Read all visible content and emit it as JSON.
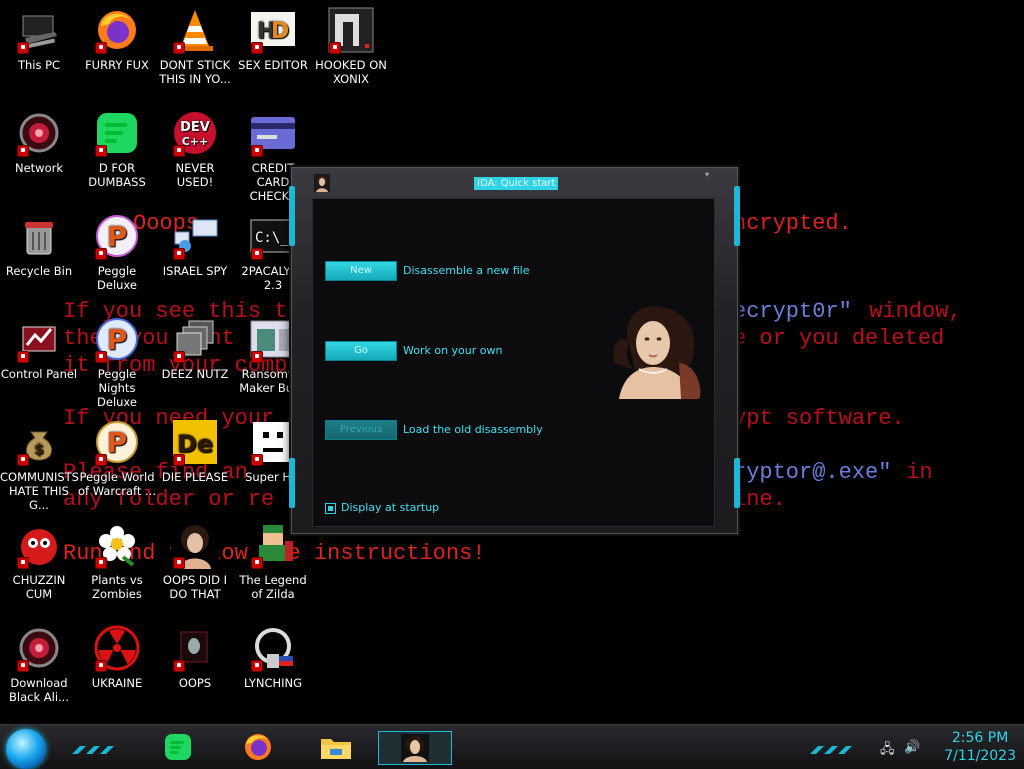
{
  "wallpaper": {
    "line1": "Ooops,",
    "line1_right": "ncrypted.",
    "line2": "If you see this t",
    "line2_right_blue": "ecrypt0r\"",
    "line2_right": " window,",
    "line3": "then you cant",
    "line3_right": "e or you deleted",
    "line4": "it from your comp",
    "line5": "If you need your",
    "line5_right": "ypt software.",
    "line6": "Please find an",
    "line6_right_blue": "ryptor@.exe\"",
    "line6_right": " in",
    "line7": "any folder or re",
    "line7_right": "ine.",
    "line8": "Run and follow the instructions!"
  },
  "desktop_icons": [
    {
      "label": "This PC"
    },
    {
      "label": "FURRY FUX"
    },
    {
      "label": "DONT STICK THIS IN YO..."
    },
    {
      "label": "SEX EDITOR"
    },
    {
      "label": "HOOKED ON XONIX"
    },
    {
      "label": "Network"
    },
    {
      "label": "D FOR DUMBASS"
    },
    {
      "label": "NEVER USED!"
    },
    {
      "label": "CREDIT CARD CHECKE"
    },
    {
      "label": "Recycle Bin"
    },
    {
      "label": "Peggle Deluxe"
    },
    {
      "label": "ISRAEL SPY"
    },
    {
      "label": "2PACALYPS 2.3"
    },
    {
      "label": "Control Panel"
    },
    {
      "label": "Peggle Nights Deluxe"
    },
    {
      "label": "DEEZ NUTZ"
    },
    {
      "label": "Ransomwa Maker Build"
    },
    {
      "label": "COMMUNISTS HATE THIS G..."
    },
    {
      "label": "Peggle World of Warcraft ..."
    },
    {
      "label": "DIE PLEASE"
    },
    {
      "label": "Super Hik"
    },
    {
      "label": "CHUZZIN CUM"
    },
    {
      "label": "Plants vs Zombies"
    },
    {
      "label": "OOPS DID I DO THAT"
    },
    {
      "label": "The Legend of Zilda"
    },
    {
      "label": "Download Black Ali..."
    },
    {
      "label": "UKRAINE"
    },
    {
      "label": "OOPS"
    },
    {
      "label": "LYNCHING"
    }
  ],
  "ida_window": {
    "title": "IDA: Quick start",
    "buttons": [
      {
        "label": "New",
        "text": "Disassemble a new file",
        "enabled": true
      },
      {
        "label": "Go",
        "text": "Work on your own",
        "enabled": true
      },
      {
        "label": "Previous",
        "text": "Load the old disassembly",
        "enabled": false
      }
    ],
    "checkbox_label": "Display at startup",
    "checkbox_checked": true
  },
  "taskbar": {
    "apps": [
      "spotify-icon",
      "firefox-icon",
      "file-explorer-icon",
      "ida-icon"
    ],
    "time": "2:56 PM",
    "date": "7/11/2023"
  },
  "colors": {
    "accent": "#2fd3e6",
    "ransom_red": "#d22222",
    "ransom_blue": "#6a7fd8"
  }
}
